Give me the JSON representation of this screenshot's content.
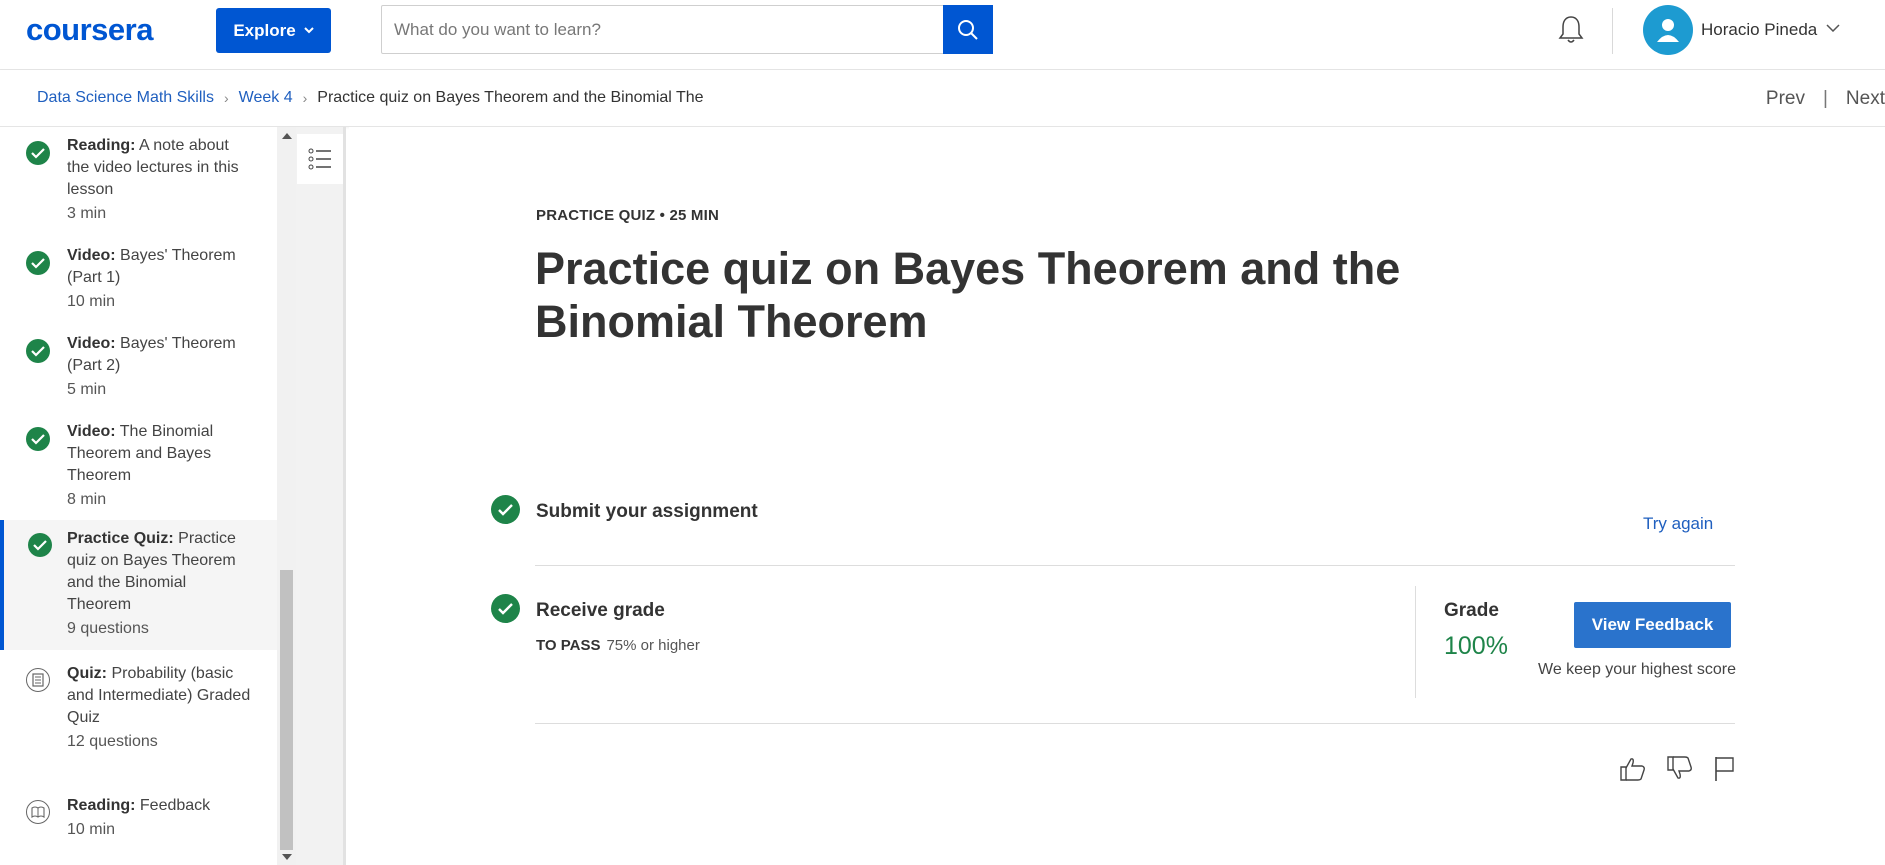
{
  "header": {
    "logo": "coursera",
    "explore_label": "Explore",
    "search_placeholder": "What do you want to learn?",
    "user_name": "Horacio Pineda"
  },
  "breadcrumb": {
    "items": [
      "Data Science Math Skills",
      "Week 4",
      "Practice quiz on Bayes Theorem and the Binomial The"
    ],
    "prev": "Prev",
    "separator": "|",
    "next": "Next"
  },
  "sidebar": {
    "items": [
      {
        "kind": "Reading:",
        "title": " A note about the video lectures in this lesson",
        "meta": "3 min",
        "status": "completed",
        "icon": "check-icon"
      },
      {
        "kind": "Video:",
        "title": " Bayes' Theorem (Part 1)",
        "meta": "10 min",
        "status": "completed",
        "icon": "check-icon"
      },
      {
        "kind": "Video:",
        "title": " Bayes' Theorem (Part 2)",
        "meta": "5 min",
        "status": "completed",
        "icon": "check-icon"
      },
      {
        "kind": "Video:",
        "title": " The Binomial Theorem and Bayes Theorem",
        "meta": "8 min",
        "status": "completed",
        "icon": "check-icon"
      },
      {
        "kind": "Practice Quiz:",
        "title": " Practice quiz on Bayes Theorem and the Binomial Theorem",
        "meta": "9 questions",
        "status": "completed",
        "icon": "check-icon",
        "active": true
      },
      {
        "kind": "Quiz:",
        "title": " Probability (basic and Intermediate) Graded Quiz",
        "meta": "12 questions",
        "status": "pending",
        "icon": "quiz-icon"
      },
      {
        "kind": "Reading:",
        "title": " Feedback",
        "meta": "10 min",
        "status": "pending",
        "icon": "reading-icon"
      }
    ]
  },
  "main": {
    "eyebrow": "PRACTICE QUIZ • 25 MIN",
    "title": "Practice quiz on Bayes Theorem and the Binomial Theorem",
    "submit_title": "Submit your assignment",
    "try_again": "Try again",
    "receive_title": "Receive grade",
    "to_pass_label": "TO PASS",
    "to_pass_value": "75% or higher",
    "grade_label": "Grade",
    "grade_value": "100%",
    "view_feedback": "View Feedback",
    "keep_note": "We keep your highest score"
  },
  "colors": {
    "brand": "#0056d2",
    "success": "#1e8449",
    "link": "#1f5fbf"
  }
}
